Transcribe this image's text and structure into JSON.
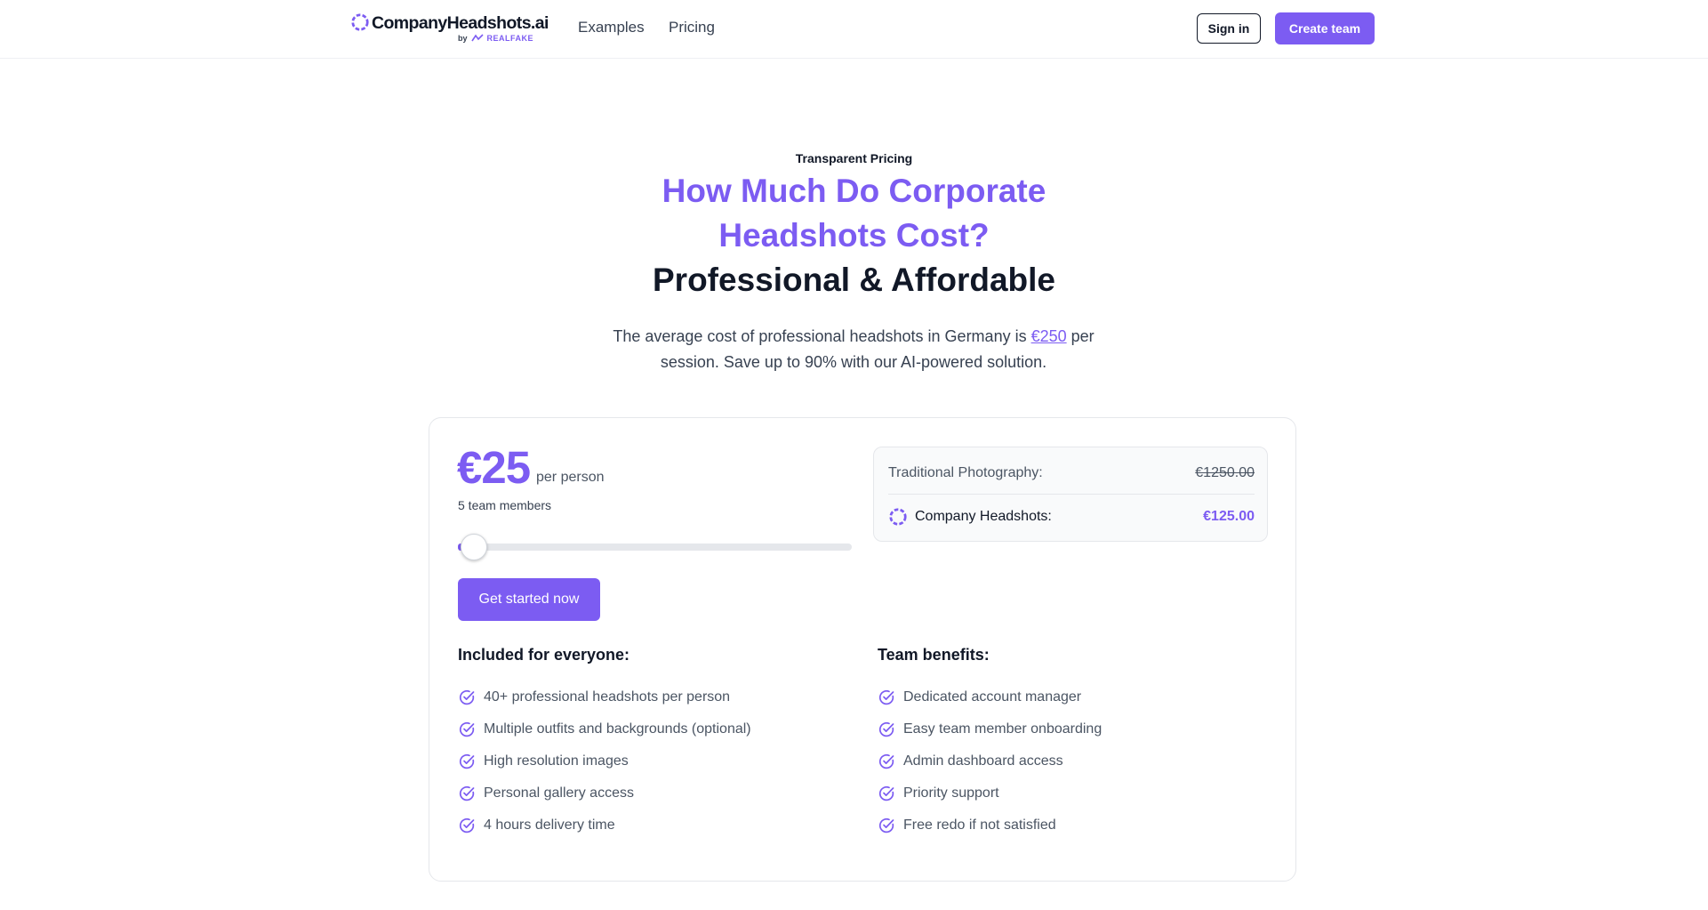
{
  "header": {
    "logo_text": "CompanyHeadshots.ai",
    "logo_by": "by",
    "logo_brand": "REALFAKE",
    "nav": [
      "Examples",
      "Pricing"
    ],
    "sign_in": "Sign in",
    "create_team": "Create team"
  },
  "hero": {
    "eyebrow": "Transparent Pricing",
    "title_line1": "How Much Do Corporate",
    "title_line2": "Headshots Cost?",
    "title_line3": "Professional & Affordable",
    "sub_before": "The average cost of professional headshots in Germany is ",
    "sub_link": "€250",
    "sub_after": " per session. Save up to 90% with our AI-powered solution."
  },
  "pricing": {
    "price": "€25",
    "per": "per person",
    "members": "5 team members",
    "slider_fraction": 0.01,
    "cta": "Get started now",
    "traditional_label": "Traditional Photography:",
    "traditional_value": "€1250.00",
    "company_label": "Company Headshots:",
    "company_value": "€125.00"
  },
  "included": {
    "title": "Included for everyone:",
    "items": [
      "40+ professional headshots per person",
      "Multiple outfits and backgrounds (optional)",
      "High resolution images",
      "Personal gallery access",
      "4 hours delivery time"
    ]
  },
  "team": {
    "title": "Team benefits:",
    "items": [
      "Dedicated account manager",
      "Easy team member onboarding",
      "Admin dashboard access",
      "Priority support",
      "Free redo if not satisfied"
    ]
  },
  "colors": {
    "accent": "#7c5cf2",
    "text": "#111827",
    "muted": "#4b5563"
  }
}
